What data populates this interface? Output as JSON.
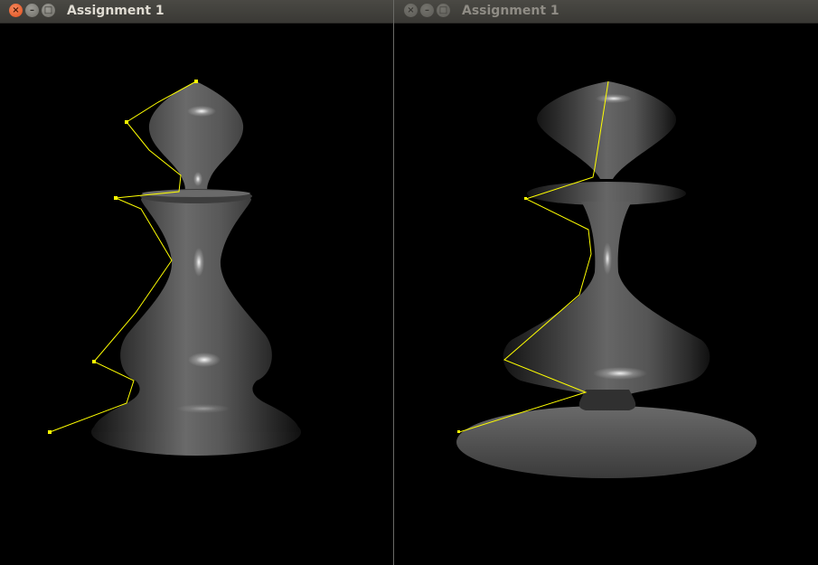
{
  "left_window": {
    "title": "Assignment 1",
    "close_glyph": "×",
    "minimize_glyph": "–",
    "maximize_glyph": "□",
    "active": true
  },
  "right_window": {
    "title": "Assignment 1",
    "close_glyph": "×",
    "minimize_glyph": "–",
    "maximize_glyph": "□",
    "active": false
  },
  "colors": {
    "background": "#000000",
    "surface": "#5a5a5a",
    "control_polygon": "#ffff00"
  }
}
